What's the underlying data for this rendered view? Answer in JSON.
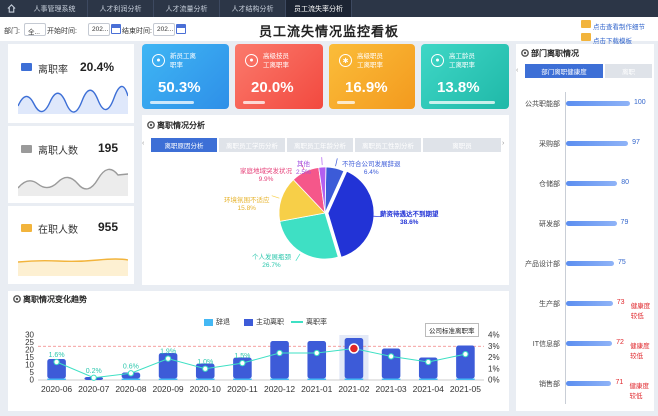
{
  "nav": {
    "tabs": [
      {
        "label": "人事管理系统",
        "active": false
      },
      {
        "label": "人才利润分析",
        "active": false
      },
      {
        "label": "人才流量分析",
        "active": false
      },
      {
        "label": "人才结构分析",
        "active": false
      },
      {
        "label": "员工流失率分析",
        "active": true
      }
    ]
  },
  "filters": {
    "dept_label": "部门:",
    "dept_value": "全...",
    "start_label": "开始时间:",
    "start_value": "202...",
    "end_label": "结束时间:",
    "end_value": "202..."
  },
  "page": {
    "title": "员工流失情况监控看板",
    "link_tutorial": "点击查看制作细节",
    "link_download": "点击下载模板"
  },
  "kpis": [
    {
      "name": "离职率",
      "value": "20.4%",
      "icon": "chart-icon",
      "color": "#3d6fd6",
      "line": "#3d6fd6"
    },
    {
      "name": "离职人数",
      "value": "195",
      "icon": "people-icon",
      "color": "#9a9a9a",
      "line": "#9a9a9a"
    },
    {
      "name": "在职人数",
      "value": "955",
      "icon": "person-icon",
      "color": "#f2b43c",
      "line": "#f2b43c"
    }
  ],
  "cards": [
    {
      "title1": "新员工离",
      "title2": "职率",
      "value": "50.3%",
      "icon": "person-icon",
      "bar": 0.6
    },
    {
      "title1": "高级技员",
      "title2": "工离职率",
      "value": "20.0%",
      "icon": "person-icon",
      "bar": 0.28
    },
    {
      "title1": "高级职员",
      "title2": "工离职率",
      "value": "16.9%",
      "icon": "gear-icon",
      "bar": 0.22
    },
    {
      "title1": "高工龄员",
      "title2": "工离职率",
      "value": "13.8%",
      "icon": "person-icon",
      "bar": 0.85
    }
  ],
  "pie_section": {
    "title": "离职情况分析",
    "tabs": [
      "离职原因分析",
      "离职员工学历分析",
      "离职员工年龄分析",
      "离职员工性别分析",
      "离职员"
    ]
  },
  "pie": {
    "slices": [
      {
        "name": "不符合公司发展辞退",
        "value": 6.4,
        "label": "6.4%",
        "color": "#3c5bd8"
      },
      {
        "name": "薪资待遇达不到期望",
        "value": 38.6,
        "label": "38.6%",
        "color": "#2233d6"
      },
      {
        "name": "个人发展瓶颈",
        "value": 26.7,
        "label": "26.7%",
        "color": "#3ee0c4"
      },
      {
        "name": "环境氛围不适应",
        "value": 15.8,
        "label": "15.8%",
        "color": "#f7cf48"
      },
      {
        "name": "家庭地域突发状况",
        "value": 9.9,
        "label": "9.9%",
        "color": "#f5578a"
      },
      {
        "name": "其他",
        "value": 2.5,
        "label": "2.5%",
        "color": "#b35ff0"
      }
    ]
  },
  "dept_section": {
    "title": "部门离职情况",
    "tabs": [
      "部门离职健康度",
      "离职"
    ]
  },
  "depts": [
    {
      "name": "公共职能部",
      "value": 100,
      "warn": ""
    },
    {
      "name": "采购部",
      "value": 97,
      "warn": ""
    },
    {
      "name": "仓储部",
      "value": 80,
      "warn": ""
    },
    {
      "name": "研发部",
      "value": 79,
      "warn": ""
    },
    {
      "name": "产品设计部",
      "value": 75,
      "warn": ""
    },
    {
      "name": "生产部",
      "value": 73,
      "warn": "健康度较低"
    },
    {
      "name": "IT信息部",
      "value": 72,
      "warn": "健康度较低"
    },
    {
      "name": "销售部",
      "value": 71,
      "warn": "健康度较低"
    }
  ],
  "trend_section": {
    "title": "离职情况变化趋势",
    "legend": [
      "辞退",
      "主动离职",
      "离职率"
    ],
    "standard_label": "公司标准离职率"
  },
  "chart_data": {
    "type": "bar",
    "categories": [
      "2020-06",
      "2020-07",
      "2020-08",
      "2020-09",
      "2020-10",
      "2020-11",
      "2020-12",
      "2021-01",
      "2021-02",
      "2021-03",
      "2021-04",
      "2021-05"
    ],
    "series": [
      {
        "name": "辞退",
        "values": [
          1,
          0,
          1,
          1,
          1,
          1,
          1,
          1,
          1,
          1,
          1,
          1
        ]
      },
      {
        "name": "主动离职",
        "values": [
          13,
          2,
          4,
          17,
          10,
          14,
          25,
          25,
          27,
          20,
          14,
          22
        ]
      },
      {
        "name": "离职率",
        "values": [
          1.6,
          0.2,
          0.6,
          1.9,
          1.0,
          1.5,
          2.4,
          2.4,
          2.8,
          2.1,
          1.6,
          2.3
        ]
      }
    ],
    "rate_labels": [
      "1.6%",
      "0.2%",
      "0.6%",
      "1.9%",
      "1.0%",
      "1.5%",
      "",
      "",
      "",
      "",
      "",
      ""
    ],
    "yticks_left": [
      "0",
      "5",
      "10",
      "15",
      "20",
      "25",
      "30"
    ],
    "yticks_right": [
      "0%",
      "1%",
      "2%",
      "3%",
      "4%"
    ],
    "ylim": [
      0,
      30
    ],
    "y2lim": [
      0,
      4
    ],
    "standard_rate": 3.0,
    "highlight_index": 8
  }
}
